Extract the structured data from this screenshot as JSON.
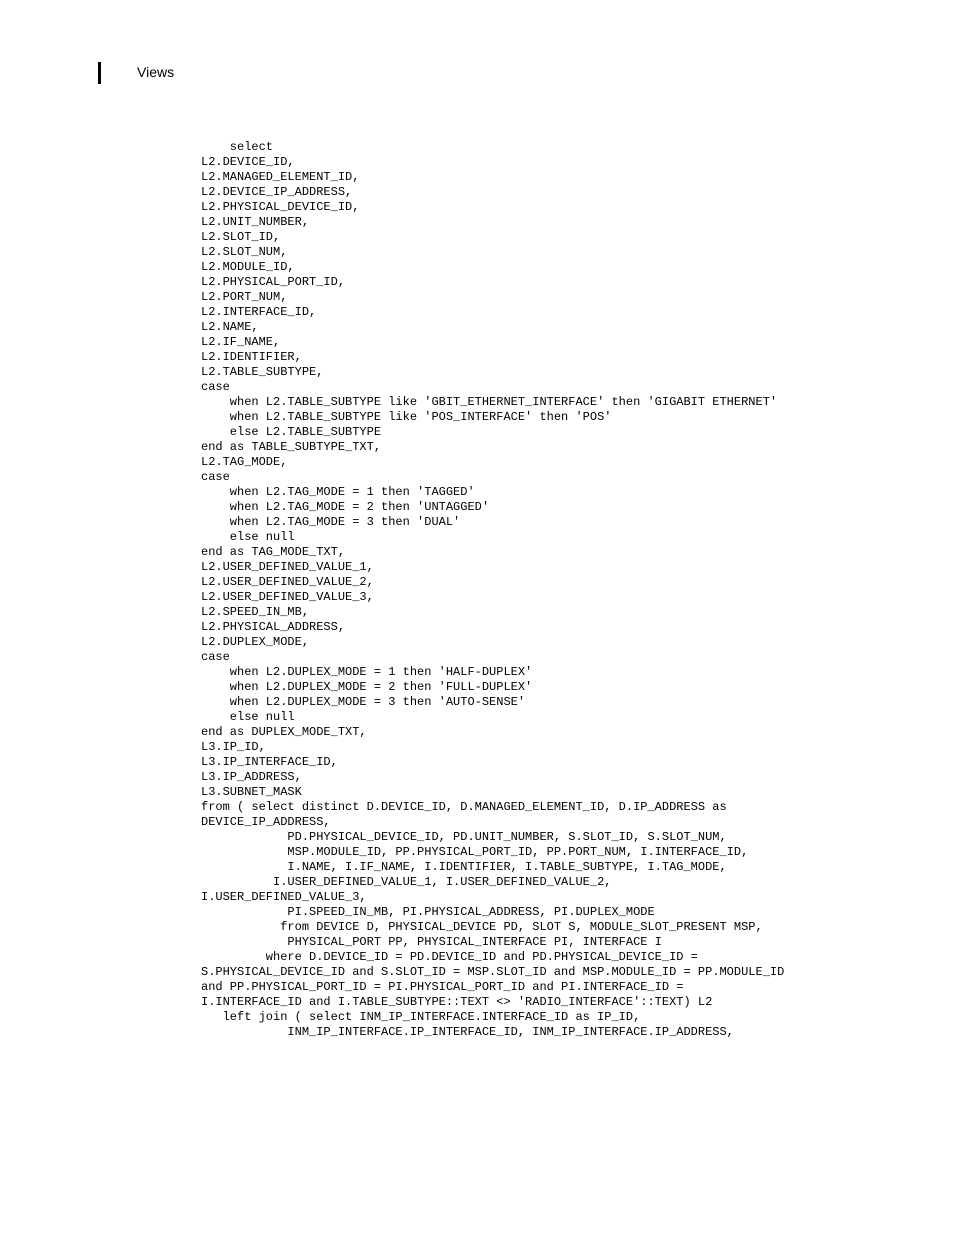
{
  "header": {
    "title": "Views"
  },
  "code": {
    "text": "    select\nL2.DEVICE_ID,\nL2.MANAGED_ELEMENT_ID,\nL2.DEVICE_IP_ADDRESS,\nL2.PHYSICAL_DEVICE_ID,\nL2.UNIT_NUMBER,\nL2.SLOT_ID,\nL2.SLOT_NUM,\nL2.MODULE_ID,\nL2.PHYSICAL_PORT_ID,\nL2.PORT_NUM,\nL2.INTERFACE_ID,\nL2.NAME,\nL2.IF_NAME,\nL2.IDENTIFIER,\nL2.TABLE_SUBTYPE,\ncase\n    when L2.TABLE_SUBTYPE like 'GBIT_ETHERNET_INTERFACE' then 'GIGABIT ETHERNET'\n    when L2.TABLE_SUBTYPE like 'POS_INTERFACE' then 'POS'\n    else L2.TABLE_SUBTYPE\nend as TABLE_SUBTYPE_TXT,\nL2.TAG_MODE,\ncase\n    when L2.TAG_MODE = 1 then 'TAGGED'\n    when L2.TAG_MODE = 2 then 'UNTAGGED'\n    when L2.TAG_MODE = 3 then 'DUAL'\n    else null\nend as TAG_MODE_TXT,\nL2.USER_DEFINED_VALUE_1,\nL2.USER_DEFINED_VALUE_2,\nL2.USER_DEFINED_VALUE_3,\nL2.SPEED_IN_MB,\nL2.PHYSICAL_ADDRESS,\nL2.DUPLEX_MODE,\ncase\n    when L2.DUPLEX_MODE = 1 then 'HALF-DUPLEX'\n    when L2.DUPLEX_MODE = 2 then 'FULL-DUPLEX'\n    when L2.DUPLEX_MODE = 3 then 'AUTO-SENSE'\n    else null\nend as DUPLEX_MODE_TXT,\nL3.IP_ID,\nL3.IP_INTERFACE_ID,\nL3.IP_ADDRESS,\nL3.SUBNET_MASK\nfrom ( select distinct D.DEVICE_ID, D.MANAGED_ELEMENT_ID, D.IP_ADDRESS as \nDEVICE_IP_ADDRESS, \n            PD.PHYSICAL_DEVICE_ID, PD.UNIT_NUMBER, S.SLOT_ID, S.SLOT_NUM, \n            MSP.MODULE_ID, PP.PHYSICAL_PORT_ID, PP.PORT_NUM, I.INTERFACE_ID, \n            I.NAME, I.IF_NAME, I.IDENTIFIER, I.TABLE_SUBTYPE, I.TAG_MODE, \n          I.USER_DEFINED_VALUE_1, I.USER_DEFINED_VALUE_2, \nI.USER_DEFINED_VALUE_3, \n            PI.SPEED_IN_MB, PI.PHYSICAL_ADDRESS, PI.DUPLEX_MODE\n           from DEVICE D, PHYSICAL_DEVICE PD, SLOT S, MODULE_SLOT_PRESENT MSP, \n            PHYSICAL_PORT PP, PHYSICAL_INTERFACE PI, INTERFACE I\n         where D.DEVICE_ID = PD.DEVICE_ID and PD.PHYSICAL_DEVICE_ID = \nS.PHYSICAL_DEVICE_ID and S.SLOT_ID = MSP.SLOT_ID and MSP.MODULE_ID = PP.MODULE_ID \nand PP.PHYSICAL_PORT_ID = PI.PHYSICAL_PORT_ID and PI.INTERFACE_ID = \nI.INTERFACE_ID and I.TABLE_SUBTYPE::TEXT <> 'RADIO_INTERFACE'::TEXT) L2\n   left join ( select INM_IP_INTERFACE.INTERFACE_ID as IP_ID, \n            INM_IP_INTERFACE.IP_INTERFACE_ID, INM_IP_INTERFACE.IP_ADDRESS, "
  }
}
